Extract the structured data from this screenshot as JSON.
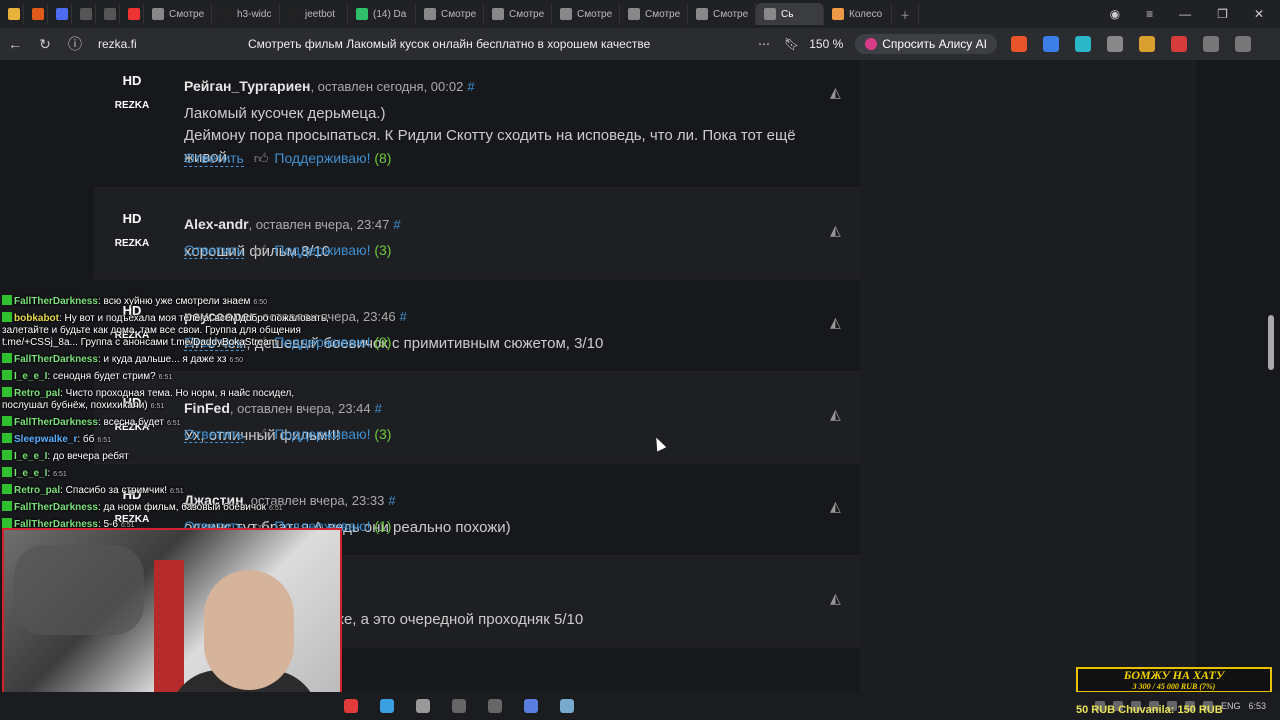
{
  "browser": {
    "tabs": [
      {
        "label": "",
        "color": "#e8b13a"
      },
      {
        "label": "",
        "color": "#e05b1b"
      },
      {
        "label": "",
        "color": "#4e6cf0"
      },
      {
        "label": "",
        "color": "#555"
      },
      {
        "label": "",
        "color": "#555"
      },
      {
        "label": "",
        "color": "#e33"
      },
      {
        "label": "Смотре",
        "color": "#888"
      },
      {
        "label": "h3-widc",
        "color": "#222"
      },
      {
        "label": "jeetbot",
        "color": "#222"
      },
      {
        "label": "(14) Da",
        "color": "#2fbf6b"
      },
      {
        "label": "Смотре",
        "color": "#888"
      },
      {
        "label": "Смотре",
        "color": "#888"
      },
      {
        "label": "Смотре",
        "color": "#888"
      },
      {
        "label": "Смотре",
        "color": "#888"
      },
      {
        "label": "Смотре",
        "color": "#888"
      },
      {
        "label": "Сь",
        "color": "#888",
        "active": true
      },
      {
        "label": "Колесо",
        "color": "#e94"
      }
    ],
    "domain": "rezka.fi",
    "page_title": "Смотреть фильм Лакомый кусок онлайн бесплатно в хорошем качестве",
    "zoom": "150 %",
    "alice": "Спросить Алису AI"
  },
  "comments": [
    {
      "author": "Рейган_Тургариен",
      "meta": ", оставлен сегодня, 00:02",
      "text": "Лакомый кусочек дерьмеца.)\nДеймону пора просыпаться. К Ридли Скотту сходить на исповедь, что ли. Пока тот ещё живой.",
      "reply": "Ответить",
      "like": "Поддерживаю!",
      "count": "(8)"
    },
    {
      "author": "Alex-andr",
      "meta": ", оставлен вчера, 23:47",
      "text": "хороший фильм 8/10",
      "reply": "Ответить",
      "like": "Поддерживаю!",
      "count": "(3)"
    },
    {
      "author": "psycooper",
      "meta": ", оставлен вчера, 23:46",
      "text": "Ни о чем, дешевый боевичок с примитивным сюжетом, 3/10",
      "reply": "Ответить",
      "like": "Поддерживаю!",
      "count": "(9)"
    },
    {
      "author": "FinFed",
      "meta": ", оставлен вчера, 23:44",
      "text": "Ух, отличный фильм!!!",
      "reply": "Ответить",
      "like": "Поддерживаю!",
      "count": "(3)"
    },
    {
      "author": "Джастин",
      "meta": ", оставлен вчера, 23:33",
      "text": "одкинс тут братья.А ведь они реально похожи)",
      "reply": "Ответить",
      "like": "Поддерживаю!",
      "count": "(1)"
    },
    {
      "author": "",
      "meta": "ставлен вчера, 23:25",
      "text": "фильм Догма с ними же, а это очередной проходняк 5/10",
      "reply": "",
      "like": "ддерживаю!",
      "count": "(1)"
    }
  ],
  "avatar": {
    "hd": "HD",
    "brand": "REZKA"
  },
  "hash": "#",
  "chat": [
    {
      "nick": "FallTherDarkness",
      "msg": ": всю хуйню уже смотрели знаем",
      "time": "6:50"
    },
    {
      "nick": "bobkabot",
      "cls": "b",
      "msg": ": Ну вот и подъехала моя телега, всем добро пожаловать, залетайте и будьте как дома, там все свои. Группа для общения t.me/+CSSj_8a... Группа с анонсами t.me/DaddyBokaStream",
      "time": ""
    },
    {
      "nick": "FallTherDarkness",
      "msg": ": и куда дальше... я даже хз",
      "time": "6:50"
    },
    {
      "nick": "I_e_e_I",
      "msg": ": сенодня будет стрим?",
      "time": "6:51"
    },
    {
      "nick": "Retro_pal",
      "msg": ": Чисто проходная тема. Но норм, я найс посидел, послушал бубнёж, похихикали)",
      "time": "6:51"
    },
    {
      "nick": "FallTherDarkness",
      "msg": ": всесна будет",
      "time": "6:51"
    },
    {
      "nick": "Sleepwalke_r",
      "cls": "s",
      "msg": ": бб",
      "time": "6:51"
    },
    {
      "nick": "I_e_e_I",
      "msg": ": до вечера ребят",
      "time": ""
    },
    {
      "nick": "I_e_e_I",
      "msg": ":",
      "time": "6:51"
    },
    {
      "nick": "Retro_pal",
      "msg": ": Спасибо за стримчик!",
      "time": "6:51"
    },
    {
      "nick": "FallTherDarkness",
      "msg": ": да норм фильм, базовый боёвичок",
      "time": "6:51"
    },
    {
      "nick": "FallTherDarkness",
      "msg": ": 5-6",
      "time": "6:51"
    }
  ],
  "donation": {
    "title": "БОМЖУ НА ХАТУ",
    "sub": "3 300 / 45 000 RUB (7%)",
    "progress_percent": 7
  },
  "ticker": "50 RUB   Chuvanila: 150 RUB",
  "tray": {
    "lang": "ENG",
    "time": "6:53"
  }
}
